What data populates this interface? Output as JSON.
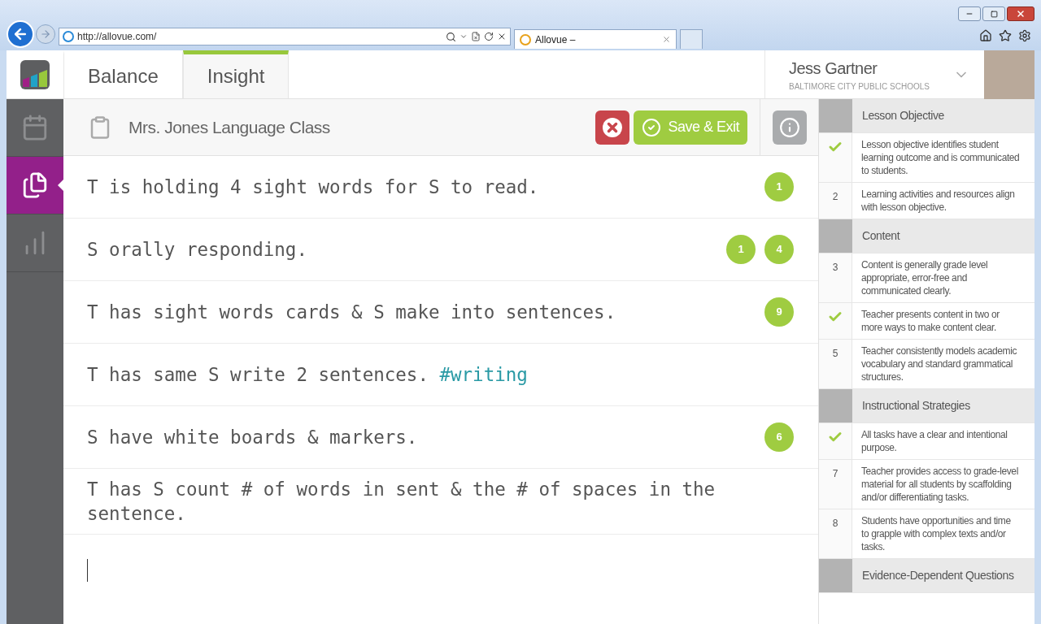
{
  "browser": {
    "url": "http://allovue.com/",
    "tab_title": "Allovue –"
  },
  "header": {
    "tabs": [
      {
        "label": "Balance",
        "selected": false
      },
      {
        "label": "Insight",
        "selected": true
      }
    ],
    "user": {
      "name": "Jess Gartner",
      "org": "BALTIMORE CITY PUBLIC SCHOOLS"
    }
  },
  "sidebar": {
    "items": [
      {
        "kind": "calendar",
        "selected": false
      },
      {
        "kind": "document",
        "selected": true
      },
      {
        "kind": "chart",
        "selected": false
      }
    ]
  },
  "toolbar": {
    "title": "Mrs. Jones Language Class",
    "save_label": "Save & Exit"
  },
  "notes": [
    {
      "text": "T is holding 4 sight words for S to read.",
      "badges": [
        "1"
      ]
    },
    {
      "text": "S orally responding.",
      "badges": [
        "1",
        "4"
      ]
    },
    {
      "text": "T has sight words cards & S make into sentences.",
      "badges": [
        "9"
      ]
    },
    {
      "text": "T has same S write 2 sentences.",
      "tag": "#writing"
    },
    {
      "text": "S have white boards & markers.",
      "badges": [
        "6"
      ]
    },
    {
      "text": "T has S count # of words in sent & the # of spaces in the sentence."
    }
  ],
  "rubric": [
    {
      "title": "Lesson Objective",
      "items": [
        {
          "checked": true,
          "text": "Lesson objective identifies student learning outcome and is communicated to students."
        },
        {
          "checked": false,
          "number": "2",
          "text": "Learning activities and resources align with lesson objective."
        }
      ]
    },
    {
      "title": "Content",
      "items": [
        {
          "checked": false,
          "number": "3",
          "text": "Content is generally grade level appropriate, error-free and communicated clearly."
        },
        {
          "checked": true,
          "text": "Teacher presents content in two or more ways to make content clear."
        },
        {
          "checked": false,
          "number": "5",
          "text": "Teacher consistently models academic vocabulary and standard grammatical structures."
        }
      ]
    },
    {
      "title": "Instructional Strategies",
      "items": [
        {
          "checked": true,
          "text": "All tasks have a clear and intentional purpose."
        },
        {
          "checked": false,
          "number": "7",
          "text": "Teacher provides access to grade-level material for all students by scaffolding and/or differentiating tasks."
        },
        {
          "checked": false,
          "number": "8",
          "text": "Students have opportunities and time to grapple with complex texts and/or tasks."
        }
      ]
    },
    {
      "title": "Evidence-Dependent Questions"
    }
  ]
}
